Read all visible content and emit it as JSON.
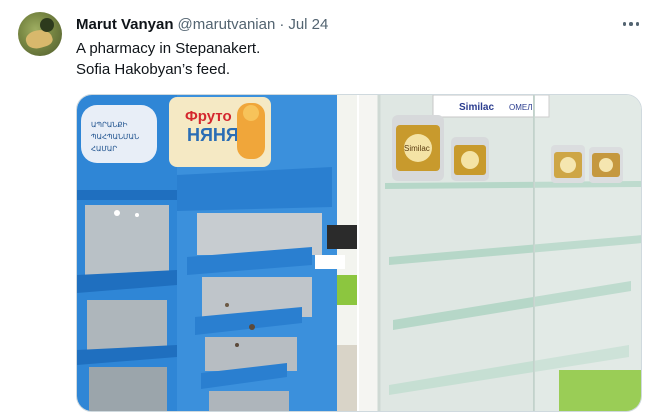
{
  "tweet": {
    "author_name": "Marut Vanyan",
    "author_handle": "@marutvanian",
    "separator": "·",
    "date": "Jul 24",
    "text_lines": [
      "A pharmacy in Stepanakert.",
      "Sofia Hakobyan’s feed."
    ]
  },
  "media": {
    "left_photo": {
      "sign_brand": "ФрутоНяня",
      "sign_line1": "Фруто",
      "sign_line2": "НЯНЯ"
    },
    "right_photo": {
      "sign_brand": "Similac",
      "sign_text": "ОМЕЛ",
      "can_label": "Similac"
    }
  },
  "icons": {
    "more": "more-horizontal-icon"
  },
  "colors": {
    "shelf_blue": "#2f86d6",
    "floor_green": "#8cc63f",
    "text_secondary": "#536471"
  }
}
